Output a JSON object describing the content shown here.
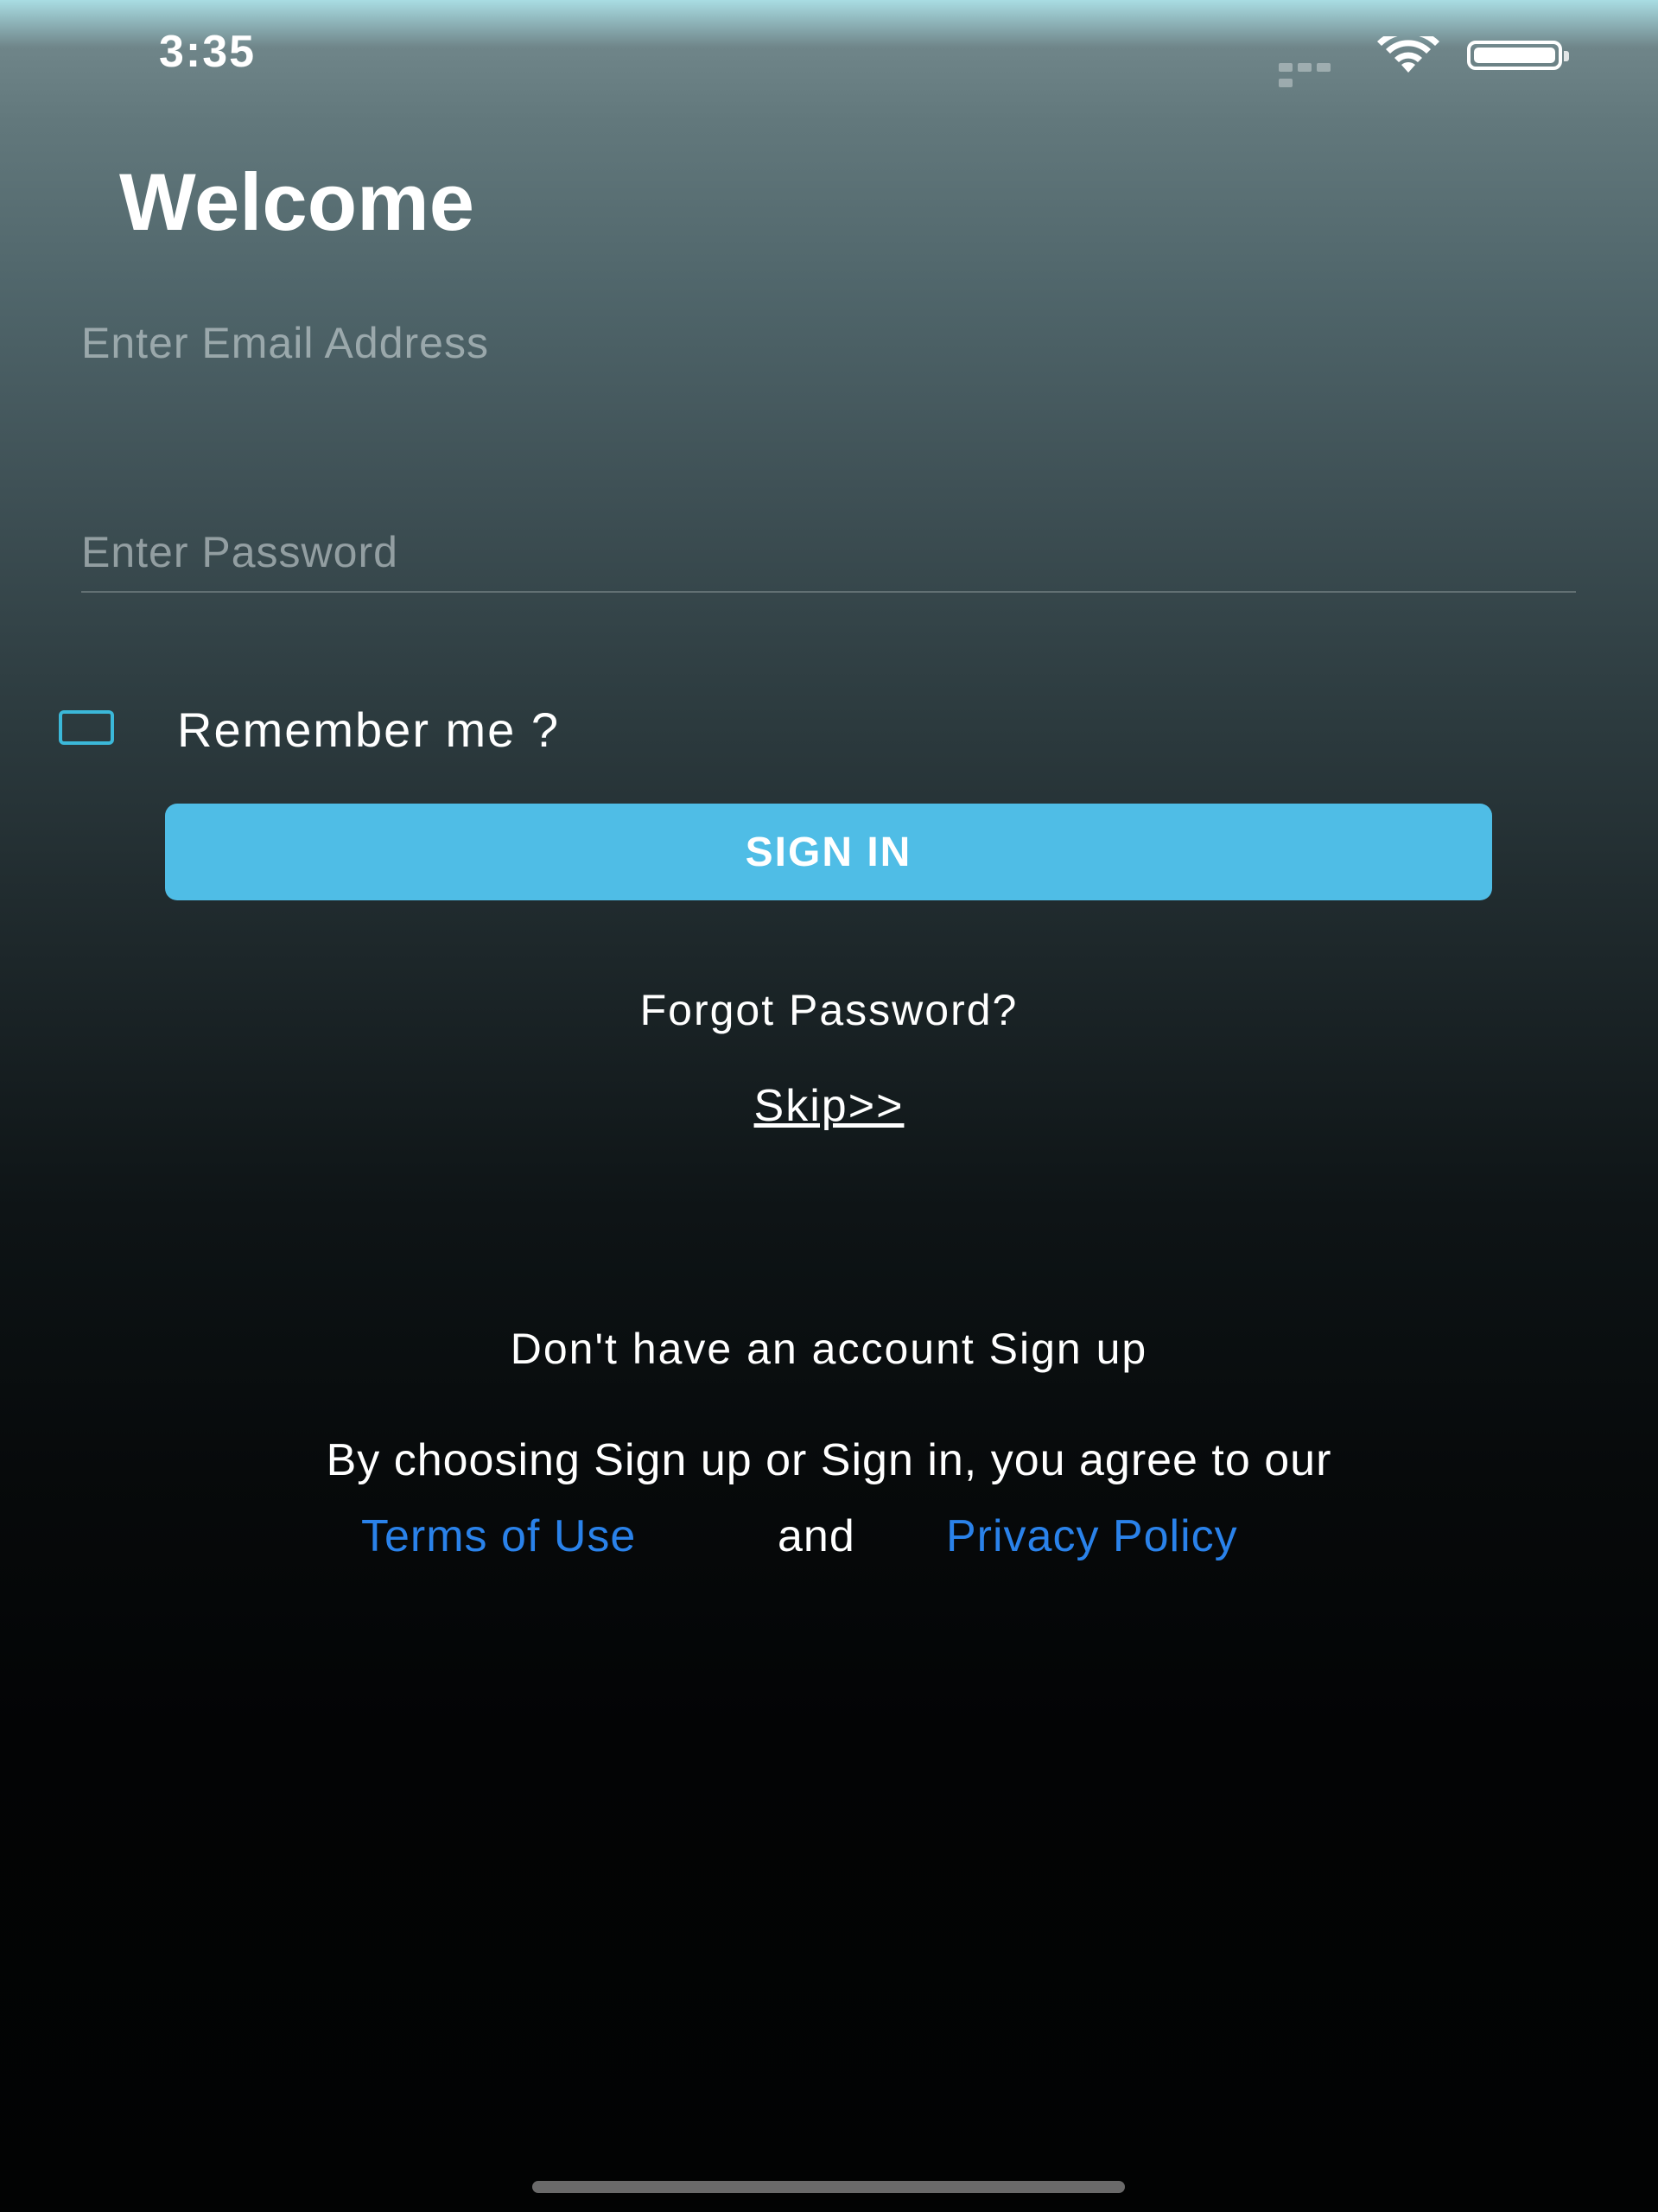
{
  "status_bar": {
    "time": "3:35",
    "signal_icon": "signal-bars-icon",
    "wifi_icon": "wifi-icon",
    "battery_icon": "battery-icon"
  },
  "login": {
    "title": "Welcome",
    "email_placeholder": "Enter Email Address",
    "email_value": "",
    "password_placeholder": "Enter Password",
    "password_value": "",
    "remember_label": "Remember me ?",
    "remember_checked": false,
    "sign_in_label": "SIGN IN",
    "forgot_password": "Forgot Password?",
    "skip": "Skip>>"
  },
  "footer": {
    "signup_prompt": "Don't have an account Sign up",
    "agree_text": "By choosing Sign up or Sign in, you agree to our",
    "terms_link": "Terms of Use",
    "and_text": "and",
    "privacy_link": "Privacy Policy"
  },
  "colors": {
    "accent_button": "#4fbde6",
    "link_blue": "#2a82ea",
    "checkbox_border": "#3bb8d9"
  }
}
